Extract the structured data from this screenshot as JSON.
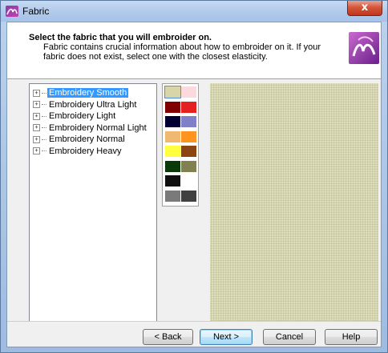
{
  "window": {
    "title": "Fabric",
    "close_label": "x"
  },
  "header": {
    "title": "Select the fabric that you will embroider on.",
    "description": "Fabric contains crucial information about how to embroider on it. If your fabric does not exist, select one with the closest elasticity."
  },
  "tree": {
    "items": [
      {
        "label": "Embroidery Smooth",
        "selected": true
      },
      {
        "label": "Embroidery Ultra Light",
        "selected": false
      },
      {
        "label": "Embroidery Light",
        "selected": false
      },
      {
        "label": "Embroidery Normal Light",
        "selected": false
      },
      {
        "label": "Embroidery Normal",
        "selected": false
      },
      {
        "label": "Embroidery Heavy",
        "selected": false
      }
    ],
    "expander_glyph": "+"
  },
  "swatches": {
    "colors": [
      "#d8d6a8",
      "#fadadd",
      "#800000",
      "#e52020",
      "#000033",
      "#8080c8",
      "#f0b870",
      "#ff9320",
      "#ffff40",
      "#8b4513",
      "#0a3a0a",
      "#808050",
      "#101010",
      "#ffffff",
      "#7a7a7a",
      "#404040"
    ],
    "selected_index": 0
  },
  "preview": {
    "fabric_color": "#d9d9b0"
  },
  "buttons": {
    "back": "< Back",
    "next": "Next >",
    "cancel": "Cancel",
    "help": "Help"
  }
}
